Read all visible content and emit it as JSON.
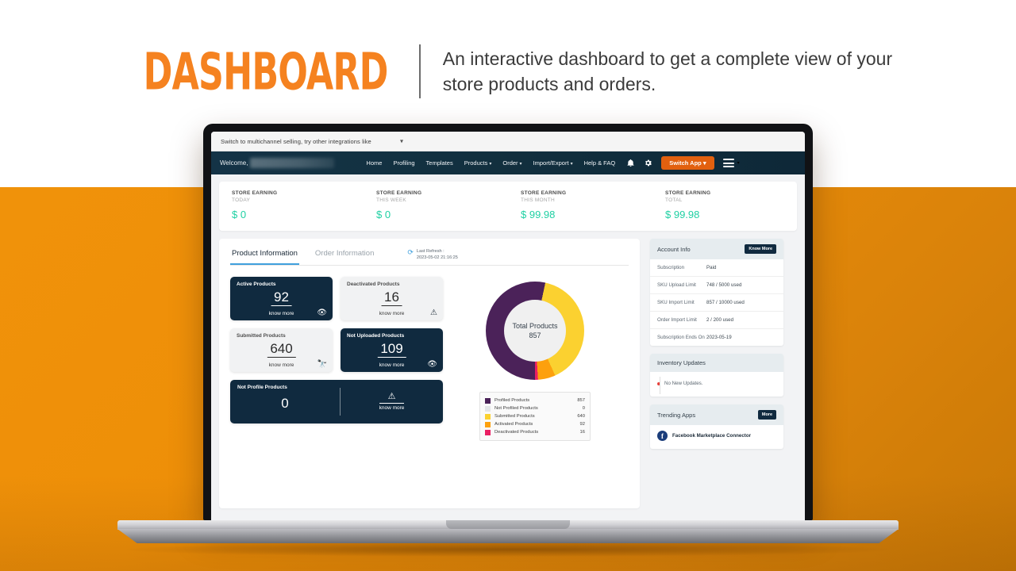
{
  "header": {
    "title": "DASHBOARD",
    "subtitle": "An interactive dashboard to get a complete view of your store products and orders."
  },
  "app": {
    "promo": {
      "text": "Switch to multichannel selling, try other integrations like",
      "caret": "▾"
    },
    "navbar": {
      "welcome": "Welcome,",
      "links": [
        {
          "label": "Home",
          "caret": ""
        },
        {
          "label": "Profiling",
          "caret": ""
        },
        {
          "label": "Templates",
          "caret": ""
        },
        {
          "label": "Products",
          "caret": "▾"
        },
        {
          "label": "Order",
          "caret": "▾"
        },
        {
          "label": "Import/Export",
          "caret": "▾"
        },
        {
          "label": "Help & FAQ",
          "caret": ""
        }
      ],
      "bell_icon": "🔔",
      "gear_icon": "⚙",
      "switch_app": "Switch App ▾",
      "burger_caret": "▾"
    },
    "earnings": {
      "label": "STORE EARNING",
      "items": [
        {
          "period": "TODAY",
          "value": "$ 0"
        },
        {
          "period": "THIS WEEK",
          "value": "$ 0"
        },
        {
          "period": "THIS MONTH",
          "value": "$ 99.98"
        },
        {
          "period": "TOTAL",
          "value": "$ 99.98"
        }
      ]
    },
    "tabs": [
      {
        "label": "Product Information",
        "active": true
      },
      {
        "label": "Order Information",
        "active": false
      }
    ],
    "refresh": {
      "icon": "⟳",
      "label": "Last Refresh :",
      "timestamp": "2023-05-02 21:16:25"
    },
    "stats": [
      {
        "title": "Active Products",
        "value": "92",
        "know_more": "know more",
        "icon": "👁",
        "theme": "dark"
      },
      {
        "title": "Deactivated Products",
        "value": "16",
        "know_more": "know more",
        "icon": "⚠",
        "theme": "light"
      },
      {
        "title": "Submitted Products",
        "value": "640",
        "know_more": "know more",
        "icon": "🔭",
        "theme": "light"
      },
      {
        "title": "Not Uploaded Products",
        "value": "109",
        "know_more": "know more",
        "icon": "👁",
        "theme": "dark"
      }
    ],
    "stat_wide": {
      "title": "Not Profile Products",
      "value": "0",
      "icon": "⚠",
      "know_more": "know more"
    },
    "account_info": {
      "title": "Account Info",
      "button": "Know More",
      "rows": [
        {
          "key": "Subscription",
          "value": "Paid"
        },
        {
          "key": "SKU Upload Limit",
          "value": "748 / 5000 used"
        },
        {
          "key": "SKU Import Limit",
          "value": "857 / 10000 used"
        },
        {
          "key": "Order Import Limit",
          "value": "2 / 200 used"
        },
        {
          "key": "Subscription Ends On",
          "value": "2023-05-19"
        }
      ]
    },
    "inventory": {
      "title": "Inventory Updates",
      "message": "No New Updates."
    },
    "trending": {
      "title": "Trending Apps",
      "button": "More",
      "apps": [
        {
          "name": "Facebook Marketplace Connector",
          "icon": "f"
        }
      ]
    }
  },
  "chart_data": {
    "type": "pie",
    "title": "Total Products",
    "total": "857",
    "legend_position": "below",
    "categories": [
      "Profiled Products",
      "Not Profiled Products",
      "Submitted Products",
      "Activated Products",
      "Deactivated Products"
    ],
    "values": [
      857,
      0,
      640,
      92,
      16
    ],
    "colors": [
      "#4b2259",
      "#e3e5e8",
      "#fbd130",
      "#fda00d",
      "#ea1f63"
    ],
    "display_values": [
      "857",
      "0",
      "640",
      "92",
      "16"
    ]
  }
}
